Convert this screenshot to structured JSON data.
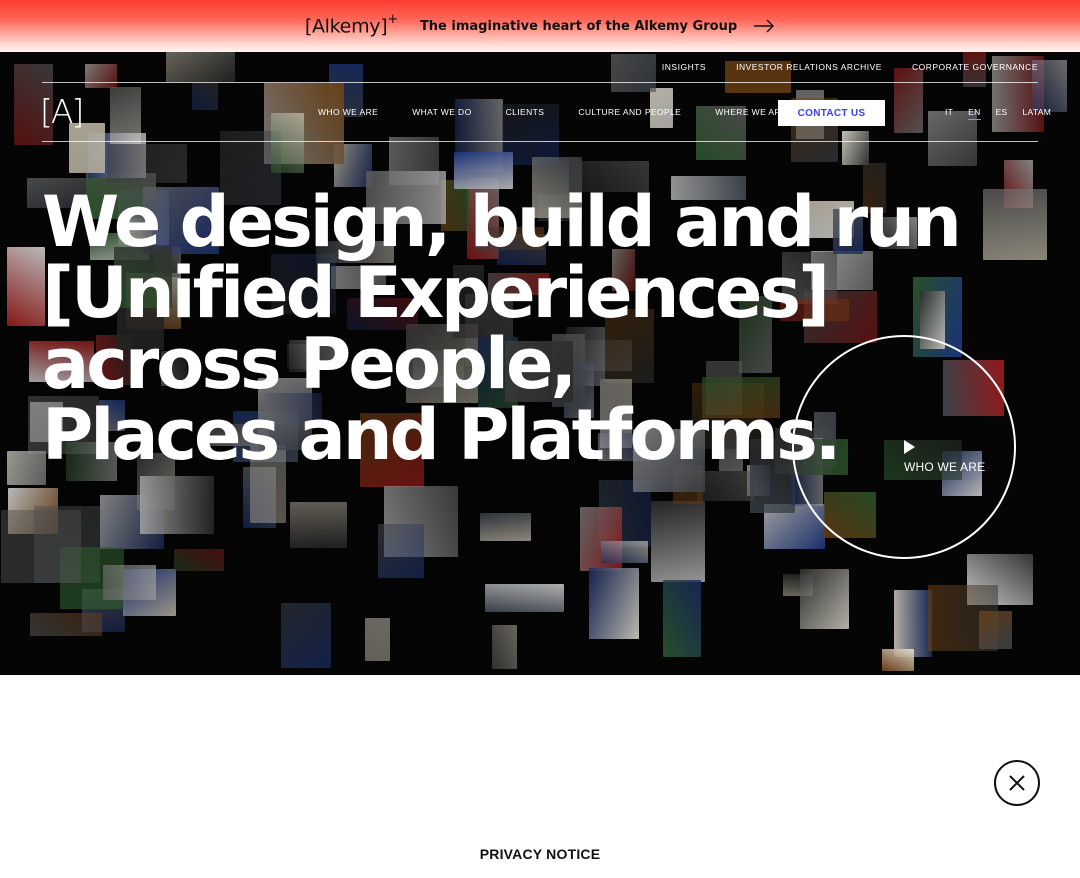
{
  "banner": {
    "brand": "[Alkemy]",
    "brand_sup": "+",
    "tagline": "The imaginative heart of the Alkemy Group",
    "arrow_icon": "arrow-right-icon"
  },
  "header": {
    "logo": "[A]",
    "top_links": [
      "INSIGHTS",
      "INVESTOR RELATIONS ARCHIVE",
      "CORPORATE GOVERNANCE"
    ],
    "nav": [
      "WHO WE ARE",
      "WHAT WE DO",
      "CLIENTS",
      "CULTURE AND PEOPLE",
      "WHERE WE ARE"
    ],
    "contact_label": "CONTACT US",
    "languages": [
      "IT",
      "EN",
      "ES",
      "LATAM"
    ],
    "active_language": "EN"
  },
  "hero": {
    "headline_lines": [
      "We design, build and run",
      "[Unified Experiences]",
      "across People,",
      "Places and Platforms."
    ],
    "circle_label": "WHO WE ARE",
    "play_icon": "play-icon"
  },
  "privacy": {
    "title": "PRIVACY NOTICE",
    "close_icon": "close-icon"
  },
  "colors": {
    "banner_red": "#ff3b30",
    "accent_blue": "#3c3cff",
    "hero_bg": "#050505"
  }
}
